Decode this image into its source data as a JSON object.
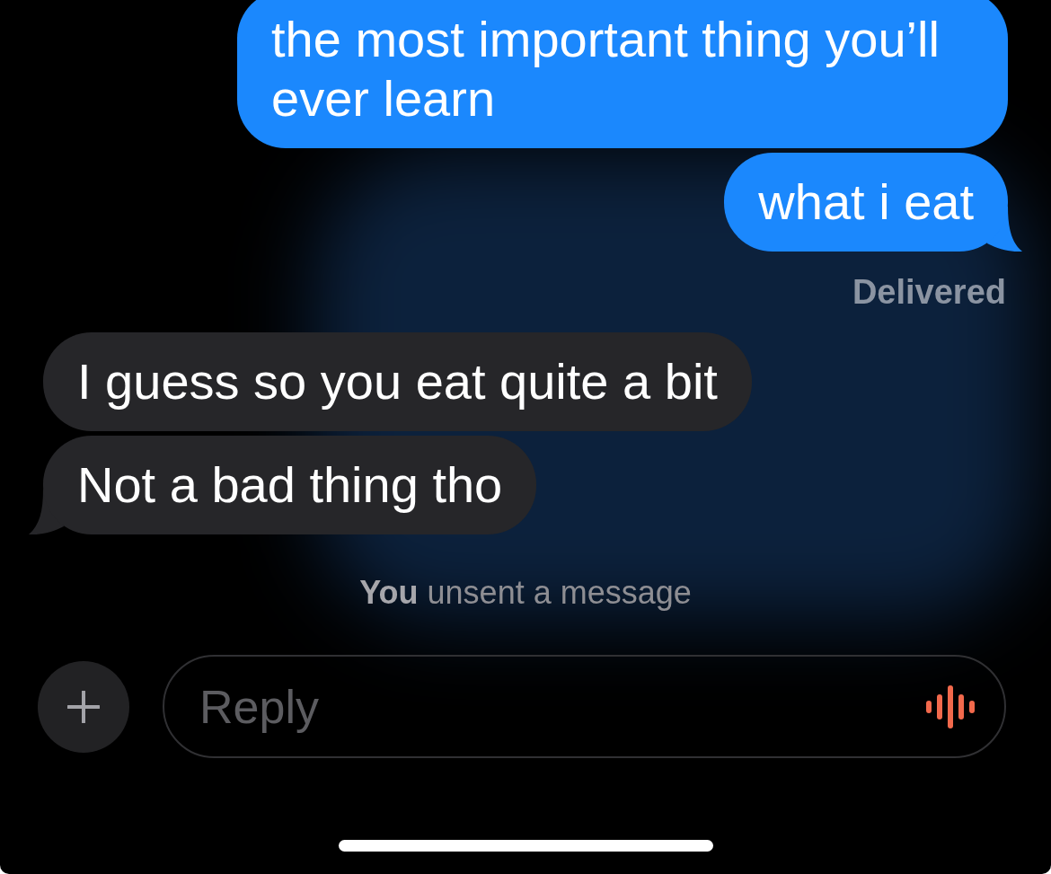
{
  "thread": [
    {
      "kind": "sent",
      "text": "the most important thing you’ll ever learn",
      "tail": false
    },
    {
      "kind": "sent",
      "text": "what i eat",
      "tail": true
    },
    {
      "kind": "status",
      "text": "Delivered"
    },
    {
      "kind": "received",
      "text": "I guess so you eat quite a bit",
      "tail": false
    },
    {
      "kind": "received",
      "text": "Not a bad thing tho",
      "tail": true
    },
    {
      "kind": "notice",
      "text": "**You** unsent a message"
    }
  ],
  "composer": {
    "placeholder": "Reply"
  }
}
